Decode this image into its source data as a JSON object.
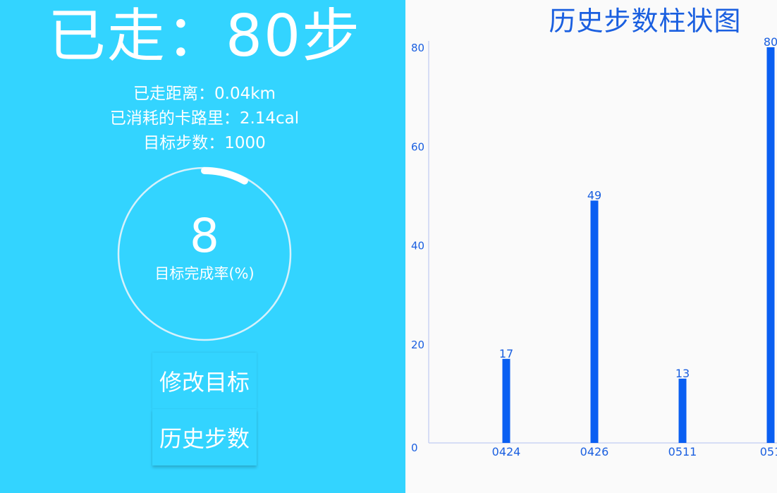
{
  "pedometer": {
    "steps_title": "已走：80步",
    "distance": "已走距离：0.04km",
    "calories": "已消耗的卡路里：2.14cal",
    "goal": "目标步数：1000",
    "completion_value": "8",
    "completion_percent": 8,
    "completion_label": "目标完成率(%)",
    "buttons": {
      "modify_goal": "修改目标",
      "history_steps": "历史步数"
    }
  },
  "colors": {
    "left_background": "#33d4ff",
    "bar": "#0a5ff2",
    "chart_text": "#1a5fe0",
    "axis": "#c9d3f3"
  },
  "chart_data": {
    "type": "bar",
    "title": "历史步数柱状图",
    "categories": [
      "0424",
      "0426",
      "0511",
      "051"
    ],
    "values": [
      17,
      49,
      13,
      80
    ],
    "value_labels": [
      "17",
      "49",
      "13",
      "80"
    ],
    "y_ticks": [
      "0",
      "20",
      "40",
      "60",
      "80"
    ],
    "ylim": [
      0,
      80
    ],
    "grid": false,
    "legend": "none"
  }
}
